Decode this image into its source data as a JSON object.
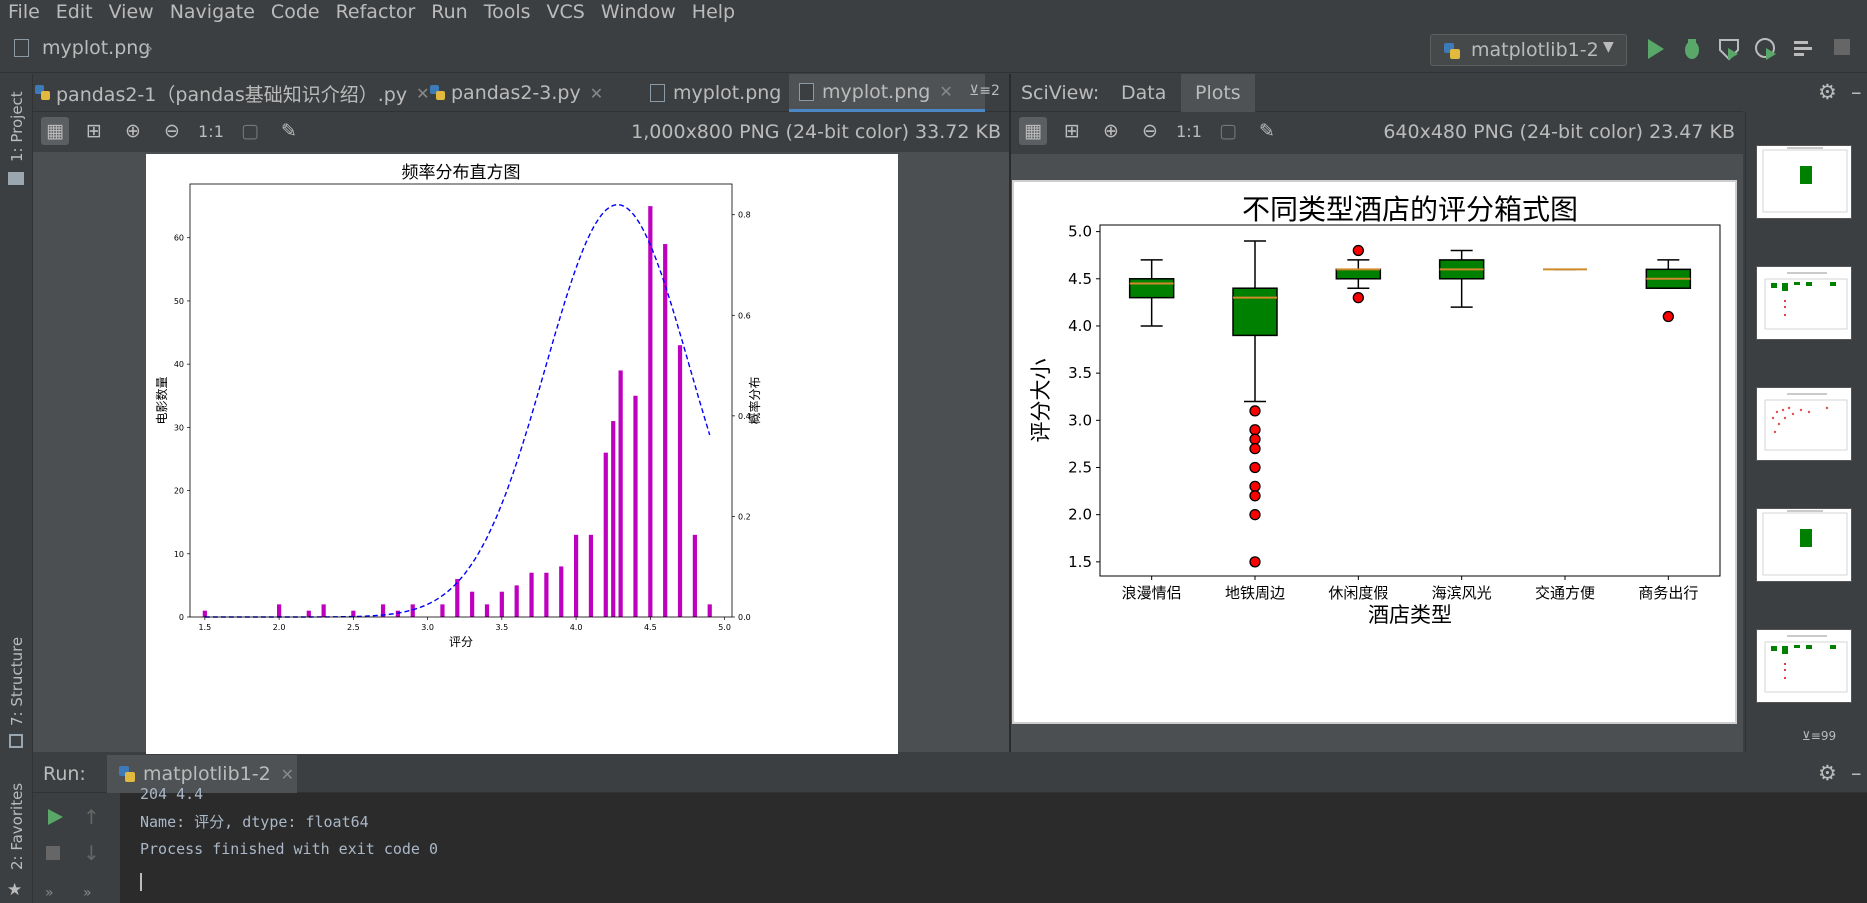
{
  "menu": [
    "File",
    "Edit",
    "View",
    "Navigate",
    "Code",
    "Refactor",
    "Run",
    "Tools",
    "VCS",
    "Window",
    "Help"
  ],
  "breadcrumb": "myplot.png",
  "run_config": "matplotlib1-2",
  "sidebar": {
    "project": "1: Project",
    "structure": "7: Structure",
    "favorites": "2: Favorites"
  },
  "tabs": [
    {
      "label": "pandas2-1（pandas基础知识介绍）.py",
      "icon": "python-file-icon"
    },
    {
      "label": "pandas2-3.py",
      "icon": "python-file-icon"
    },
    {
      "label": "myplot.png",
      "icon": "image-file-icon"
    },
    {
      "label": "myplot.png",
      "icon": "image-file-icon",
      "active": true
    }
  ],
  "tabs_overflow": "⊻≡2",
  "left_viewer": {
    "info": "1,000x800 PNG (24-bit color) 33.72 KB",
    "zoom_label": "1:1"
  },
  "sciview": {
    "title": "SciView:",
    "tabs": [
      "Data",
      "Plots"
    ],
    "info": "640x480 PNG (24-bit color) 23.47 KB",
    "zoom_label": "1:1",
    "thumb_count": "⊻≡99"
  },
  "run": {
    "label": "Run:",
    "tab": "matplotlib1-2"
  },
  "console": {
    "partial": "204    4.4",
    "line1": "Name: 评分, dtype: float64",
    "line2": "Process finished with exit code 0"
  },
  "colors": {
    "bar": "#bf00bf",
    "curve": "#0000ff",
    "box": "#008000",
    "median": "#d08a2a",
    "flier": "#ff0000",
    "accent": "#4a88c7"
  },
  "chart_data": [
    {
      "type": "bar",
      "title": "频率分布直方图",
      "xlabel": "评分",
      "ylabel": "电影数量",
      "y2label": "概率分布",
      "xlim": [
        1.4,
        5.05
      ],
      "ylim": [
        0,
        68.5
      ],
      "y2lim": [
        0,
        0.8611
      ],
      "xticks": [
        1.5,
        2.0,
        2.5,
        3.0,
        3.5,
        4.0,
        4.5,
        5.0
      ],
      "xticklabels": [
        "1.5",
        "2.0",
        "2.5",
        "3.0",
        "3.5",
        "4.0",
        "4.5",
        "5.0"
      ],
      "yticks": [
        0,
        10,
        20,
        30,
        40,
        50,
        60
      ],
      "y2ticks": [
        0.0,
        0.2,
        0.4,
        0.6,
        0.8
      ],
      "y2ticklabels": [
        "0.0",
        "0.2",
        "0.4",
        "0.6",
        "0.8"
      ],
      "bars": [
        {
          "x": 1.5,
          "y": 1
        },
        {
          "x": 2.0,
          "y": 2
        },
        {
          "x": 2.2,
          "y": 1
        },
        {
          "x": 2.3,
          "y": 2
        },
        {
          "x": 2.5,
          "y": 1
        },
        {
          "x": 2.7,
          "y": 2
        },
        {
          "x": 2.8,
          "y": 1
        },
        {
          "x": 2.9,
          "y": 2
        },
        {
          "x": 3.1,
          "y": 2
        },
        {
          "x": 3.2,
          "y": 6
        },
        {
          "x": 3.3,
          "y": 4
        },
        {
          "x": 3.4,
          "y": 2
        },
        {
          "x": 3.5,
          "y": 4
        },
        {
          "x": 3.6,
          "y": 5
        },
        {
          "x": 3.7,
          "y": 7
        },
        {
          "x": 3.8,
          "y": 7
        },
        {
          "x": 3.9,
          "y": 8
        },
        {
          "x": 4.0,
          "y": 13
        },
        {
          "x": 4.1,
          "y": 13
        },
        {
          "x": 4.2,
          "y": 26
        },
        {
          "x": 4.25,
          "y": 31
        },
        {
          "x": 4.3,
          "y": 39
        },
        {
          "x": 4.4,
          "y": 35
        },
        {
          "x": 4.5,
          "y": 65
        },
        {
          "x": 4.6,
          "y": 59
        },
        {
          "x": 4.7,
          "y": 43
        },
        {
          "x": 4.8,
          "y": 13
        },
        {
          "x": 4.9,
          "y": 2
        }
      ],
      "curve": {
        "mean": 4.28,
        "std": 0.485,
        "peak": 0.82,
        "x_start": 1.5,
        "x_end": 4.9
      }
    },
    {
      "type": "box",
      "title": "不同类型酒店的评分箱式图",
      "xlabel": "酒店类型",
      "ylabel": "评分大小",
      "ylim": [
        1.35,
        5.07
      ],
      "yticks": [
        1.5,
        2.0,
        2.5,
        3.0,
        3.5,
        4.0,
        4.5,
        5.0
      ],
      "yticklabels": [
        "1.5",
        "2.0",
        "2.5",
        "3.0",
        "3.5",
        "4.0",
        "4.5",
        "5.0"
      ],
      "categories": [
        "浪漫情侣",
        "地铁周边",
        "休闲度假",
        "海滨风光",
        "交通方便",
        "商务出行"
      ],
      "boxes": [
        {
          "whislo": 4.0,
          "q1": 4.3,
          "med": 4.45,
          "q3": 4.5,
          "whishi": 4.7,
          "fliers": []
        },
        {
          "whislo": 3.2,
          "q1": 3.9,
          "med": 4.3,
          "q3": 4.4,
          "whishi": 4.9,
          "fliers": [
            3.1,
            2.9,
            2.8,
            2.7,
            2.5,
            2.3,
            2.2,
            2.0,
            1.5
          ]
        },
        {
          "whislo": 4.4,
          "q1": 4.5,
          "med": 4.6,
          "q3": 4.6,
          "whishi": 4.7,
          "fliers": [
            4.8,
            4.3
          ]
        },
        {
          "whislo": 4.2,
          "q1": 4.5,
          "med": 4.6,
          "q3": 4.7,
          "whishi": 4.8,
          "fliers": []
        },
        {
          "whislo": 4.6,
          "q1": 4.6,
          "med": 4.6,
          "q3": 4.6,
          "whishi": 4.6,
          "fliers": []
        },
        {
          "whislo": 4.4,
          "q1": 4.4,
          "med": 4.5,
          "q3": 4.6,
          "whishi": 4.7,
          "fliers": [
            4.1
          ]
        }
      ]
    }
  ]
}
